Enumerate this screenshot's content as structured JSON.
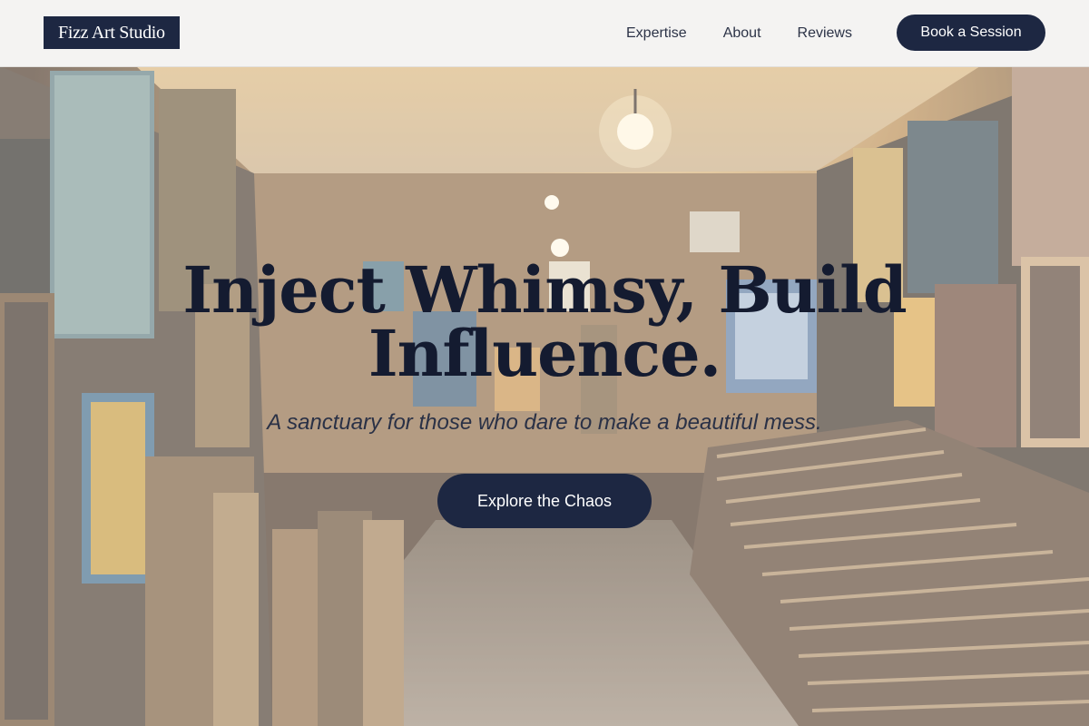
{
  "header": {
    "logo_text": "Fizz Art Studio",
    "nav": [
      {
        "label": "Expertise"
      },
      {
        "label": "About"
      },
      {
        "label": "Reviews"
      }
    ],
    "cta_label": "Book a Session"
  },
  "hero": {
    "title": "Inject Whimsy, Build Influence.",
    "subtitle": "A sanctuary for those who dare to make a beautiful mess.",
    "cta_label": "Explore the Chaos",
    "background_image": "art-gallery-storeroom-photo"
  },
  "colors": {
    "brand_navy": "#1d2742",
    "title_text": "#141b30",
    "header_bg": "#f4f3f2"
  }
}
